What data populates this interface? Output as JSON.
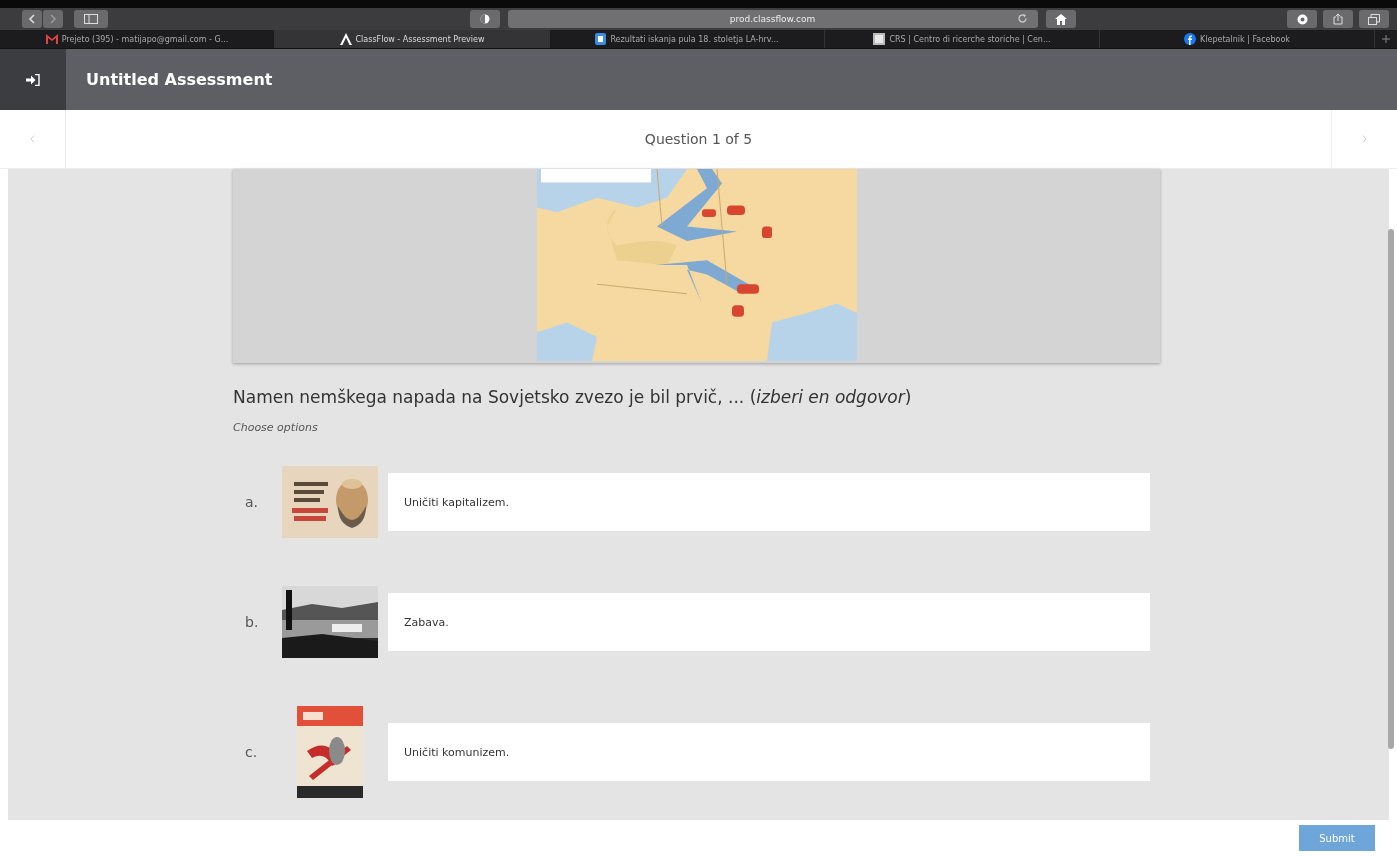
{
  "browser": {
    "url": "prod.classflow.com",
    "tabs": [
      {
        "title": "Prejeto (395) - matijapo@gmail.com - G...",
        "selected": false
      },
      {
        "title": "ClassFlow - Assessment Preview",
        "selected": true
      },
      {
        "title": "Rezultati iskanja pula 18. stoletja LA-hrv...",
        "selected": false
      },
      {
        "title": "CRS | Centro di ricerche storiche | Cen...",
        "selected": false
      },
      {
        "title": "Klepetalnik | Facebook",
        "selected": false
      }
    ]
  },
  "header": {
    "title": "Untitled Assessment"
  },
  "question_nav": {
    "label": "Question 1 of 5"
  },
  "question": {
    "text": "Namen nemškega napada na Sovjetsko zvezo je bil prvič, ... (*izberi en odgovor*)",
    "hint": "Choose options",
    "options": [
      {
        "letter": "a.",
        "text": "Uničiti kapitalizem."
      },
      {
        "letter": "b.",
        "text": "Zabava."
      },
      {
        "letter": "c.",
        "text": "Uničiti komunizem."
      }
    ]
  },
  "submit": {
    "label": "Submit",
    "disabled": true
  }
}
